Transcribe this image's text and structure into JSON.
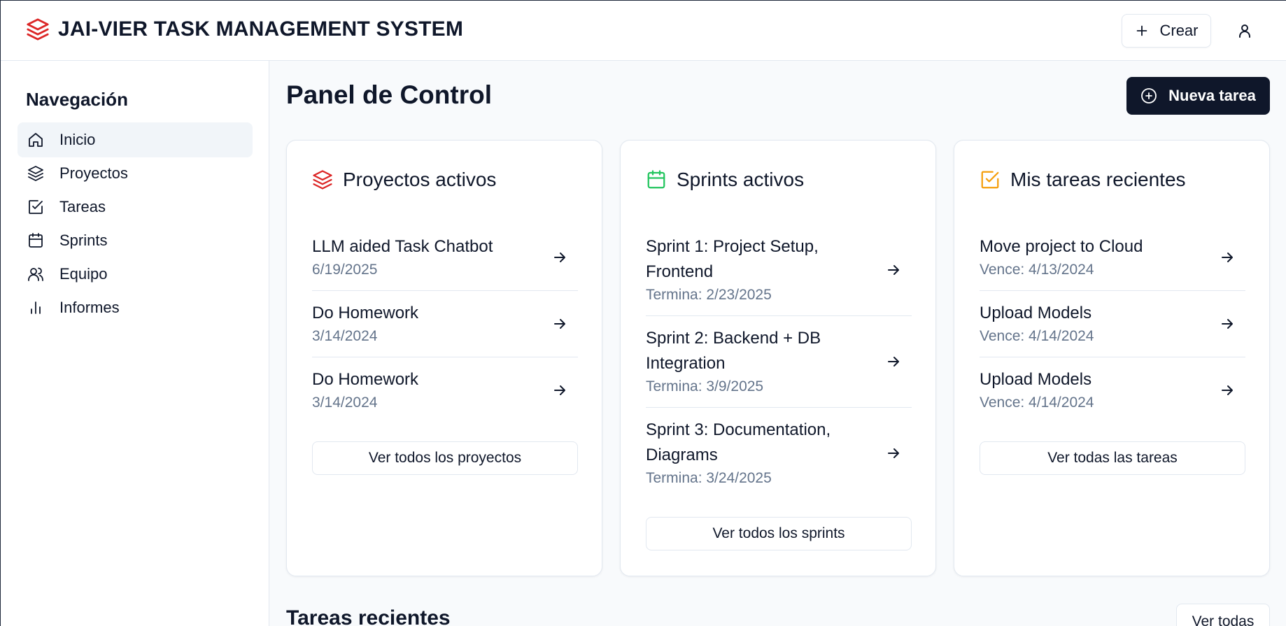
{
  "app": {
    "title": "JAI-VIER TASK MANAGEMENT SYSTEM",
    "brand_color": "#dc2626"
  },
  "header": {
    "create_label": "Crear",
    "user_icon": "user-icon"
  },
  "sidebar": {
    "title": "Navegación",
    "items": [
      {
        "label": "Inicio",
        "icon": "home-icon",
        "active": true
      },
      {
        "label": "Proyectos",
        "icon": "layers-icon",
        "active": false
      },
      {
        "label": "Tareas",
        "icon": "check-square-icon",
        "active": false
      },
      {
        "label": "Sprints",
        "icon": "calendar-icon",
        "active": false
      },
      {
        "label": "Equipo",
        "icon": "users-icon",
        "active": false
      },
      {
        "label": "Informes",
        "icon": "bar-chart-icon",
        "active": false
      }
    ]
  },
  "main": {
    "title": "Panel de Control",
    "new_task_label": "Nueva tarea",
    "cards": {
      "projects": {
        "title": "Proyectos activos",
        "icon_color": "#dc2626",
        "items": [
          {
            "title": "LLM aided Task Chatbot",
            "sub": "6/19/2025"
          },
          {
            "title": "Do Homework",
            "sub": "3/14/2024"
          },
          {
            "title": "Do Homework",
            "sub": "3/14/2024"
          }
        ],
        "button": "Ver todos los proyectos"
      },
      "sprints": {
        "title": "Sprints activos",
        "icon_color": "#22c55e",
        "items": [
          {
            "title": "Sprint 1: Project Setup, Frontend",
            "sub": "Termina: 2/23/2025"
          },
          {
            "title": "Sprint 2: Backend + DB Integration",
            "sub": "Termina: 3/9/2025"
          },
          {
            "title": "Sprint 3: Documentation, Diagrams",
            "sub": "Termina: 3/24/2025"
          }
        ],
        "button": "Ver todos los sprints"
      },
      "tasks": {
        "title": "Mis tareas recientes",
        "icon_color": "#f59e0b",
        "items": [
          {
            "title": "Move project to Cloud",
            "sub": "Vence: 4/13/2024"
          },
          {
            "title": "Upload Models",
            "sub": "Vence: 4/14/2024"
          },
          {
            "title": "Upload Models",
            "sub": "Vence: 4/14/2024"
          }
        ],
        "button": "Ver todas las tareas"
      }
    },
    "recent": {
      "title": "Tareas recientes",
      "button": "Ver todas"
    }
  }
}
